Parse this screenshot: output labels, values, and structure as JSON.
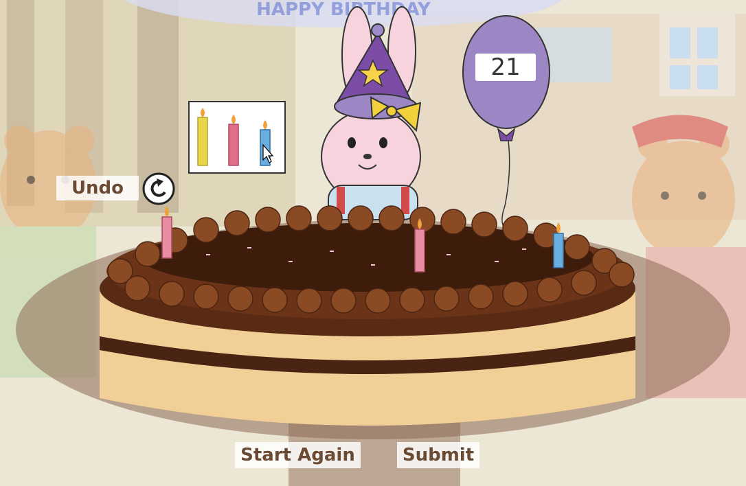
{
  "controls": {
    "undo_label": "Undo",
    "start_again_label": "Start Again",
    "submit_label": "Submit"
  },
  "balloon": {
    "number": "21",
    "color": "#9c86c4"
  },
  "candle_palette": {
    "candles": [
      {
        "name": "yellow-candle",
        "color": "#e8d64a"
      },
      {
        "name": "pink-candle",
        "color": "#e06d8a"
      },
      {
        "name": "blue-candle",
        "color": "#6aaee0"
      }
    ]
  },
  "cake": {
    "placed_candles": [
      {
        "color": "pink"
      },
      {
        "color": "pink"
      },
      {
        "color": "blue"
      }
    ]
  },
  "banner_text": "HAPPY BIRTHDAY"
}
